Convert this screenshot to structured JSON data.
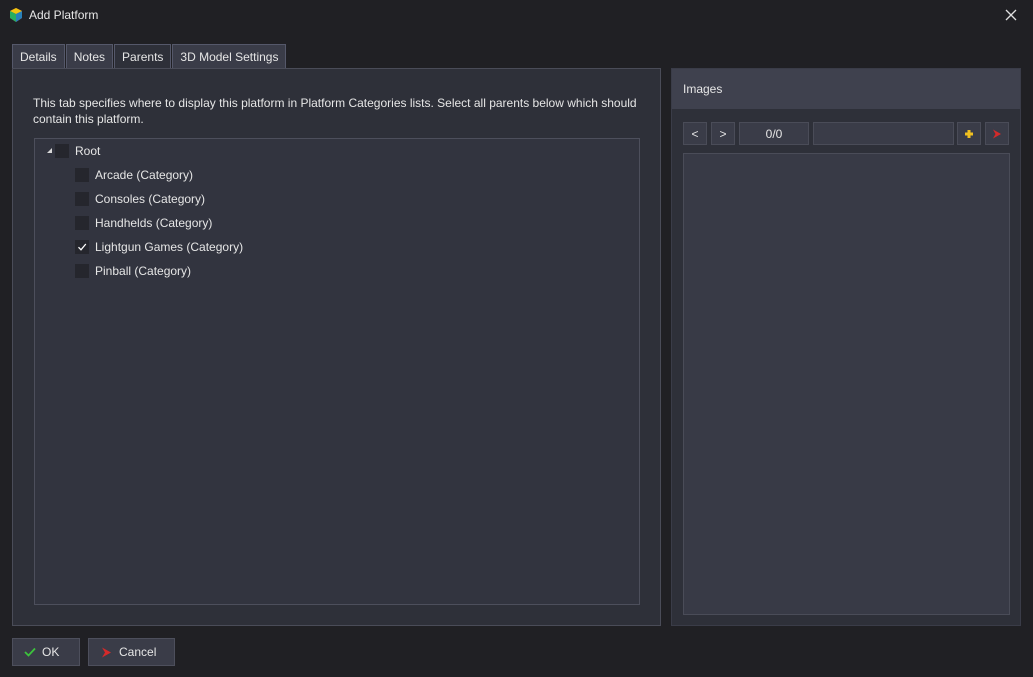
{
  "window": {
    "title": "Add Platform"
  },
  "tabs": [
    {
      "label": "Details"
    },
    {
      "label": "Notes"
    },
    {
      "label": "Parents",
      "active": true
    },
    {
      "label": "3D Model Settings"
    }
  ],
  "parents": {
    "description": "This tab specifies where to display this platform in Platform Categories lists. Select all parents below which should contain this platform.",
    "root": {
      "label": "Root",
      "checked": false,
      "expanded": true
    },
    "items": [
      {
        "label": "Arcade (Category)",
        "checked": false
      },
      {
        "label": "Consoles (Category)",
        "checked": false
      },
      {
        "label": "Handhelds (Category)",
        "checked": false
      },
      {
        "label": "Lightgun Games (Category)",
        "checked": true
      },
      {
        "label": "Pinball (Category)",
        "checked": false
      }
    ]
  },
  "images": {
    "title": "Images",
    "prev_label": "<",
    "next_label": ">",
    "counter": "0/0",
    "name_value": ""
  },
  "footer": {
    "ok_label": "OK",
    "cancel_label": "Cancel"
  },
  "colors": {
    "ok_check": "#3cc43c",
    "cancel_flag": "#d42a2a",
    "add_plus": "#f0c020",
    "remove_flag": "#d42a2a"
  }
}
